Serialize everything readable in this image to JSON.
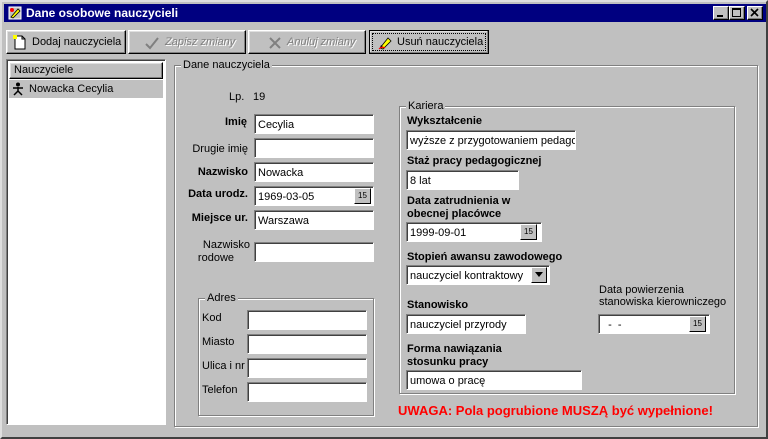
{
  "window": {
    "title": "Dane osobowe nauczycieli"
  },
  "toolbar": {
    "add_label": "Dodaj nauczyciela",
    "save_label": "Zapisz zmiany",
    "cancel_label": "Anuluj zmiany",
    "delete_label": "Usuń nauczyciela"
  },
  "teacher_list": {
    "header": "Nauczyciele",
    "items": [
      {
        "name": "Nowacka Cecylia"
      }
    ]
  },
  "details": {
    "group_title": "Dane nauczyciela",
    "lp_label": "Lp.",
    "lp_value": "19",
    "first_name_label": "Imię",
    "first_name_value": "Cecylia",
    "second_name_label": "Drugie imię",
    "second_name_value": "",
    "surname_label": "Nazwisko",
    "surname_value": "Nowacka",
    "birth_date_label": "Data urodz.",
    "birth_date_value": "1969-03-05",
    "birth_place_label": "Miejsce ur.",
    "birth_place_value": "Warszawa",
    "maiden_name_label_1": "Nazwisko",
    "maiden_name_label_2": "rodowe",
    "maiden_name_value": ""
  },
  "address": {
    "group_title": "Adres",
    "code_label": "Kod",
    "city_label": "Miasto",
    "street_label": "Ulica i nr",
    "phone_label": "Telefon",
    "code_value": "",
    "city_value": "",
    "street_value": "",
    "phone_value": ""
  },
  "career": {
    "group_title": "Kariera",
    "education_label": "Wykształcenie",
    "education_value": "wyższe z przygotowaniem pedago",
    "seniority_label": "Staż pracy pedagogicznej",
    "seniority_value": "8 lat",
    "employment_date_label_1": "Data zatrudnienia w",
    "employment_date_label_2": "obecnej placówce",
    "employment_date_value": "1999-09-01",
    "promotion_label": "Stopień awansu zawodowego",
    "promotion_value": "nauczyciel kontraktowy",
    "position_label": "Stanowisko",
    "position_value": "nauczyciel przyrody",
    "mgmt_date_label_1": "Data powierzenia",
    "mgmt_date_label_2": "stanowiska kierowniczego",
    "mgmt_date_value": "  -  -",
    "relation_label_1": "Forma nawiązania",
    "relation_label_2": "stosunku pracy",
    "relation_value": "umowa o pracę"
  },
  "calendar_button_text": "15",
  "warning": "UWAGA: Pola pogrubione MUSZĄ być wypełnione!",
  "colors": {
    "titlebar": "#000080",
    "warning": "#ff0000",
    "face": "#c0c0c0"
  },
  "icons": {
    "title": "teacher-app-icon",
    "add": "new-document-icon",
    "save": "checkmark-icon",
    "cancel": "cross-icon",
    "delete": "pen-icon",
    "teacher": "person-icon",
    "calendar": "calendar-icon",
    "dropdown": "chevron-down-icon"
  }
}
